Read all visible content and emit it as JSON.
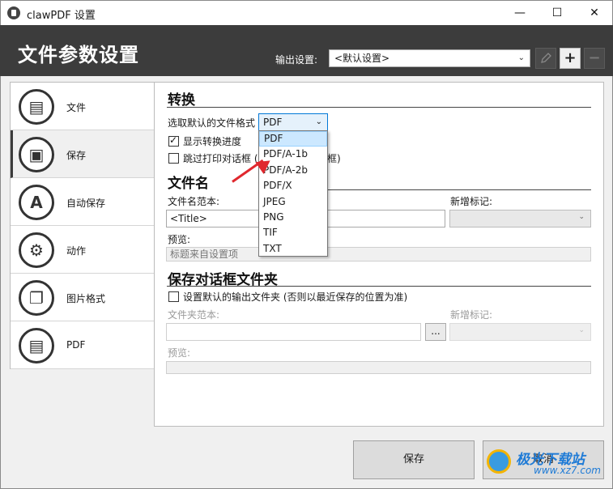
{
  "window": {
    "title": "clawPDF 设置",
    "minimize_glyph": "—",
    "maximize_glyph": "☐",
    "close_glyph": "✕"
  },
  "header": {
    "title": "文件参数设置",
    "output_label": "输出设置:",
    "output_value": "<默认设置>",
    "edit_icon": "pencil-icon",
    "add_label": "+",
    "remove_label": "−"
  },
  "sidebar": {
    "items": [
      {
        "label": "文件",
        "icon": "document-icon",
        "glyph": "▤"
      },
      {
        "label": "保存",
        "icon": "floppy-disk-icon",
        "glyph": "▣"
      },
      {
        "label": "自动保存",
        "icon": "auto-save-icon",
        "glyph": "A"
      },
      {
        "label": "动作",
        "icon": "gear-icon",
        "glyph": "⚙"
      },
      {
        "label": "图片格式",
        "icon": "images-icon",
        "glyph": "❐"
      },
      {
        "label": "PDF",
        "icon": "pdf-document-icon",
        "glyph": "▤"
      }
    ],
    "active_index": 1
  },
  "convert": {
    "title": "转换",
    "default_format_label": "选取默认的文件格式",
    "default_format_value": "PDF",
    "show_progress_label": "显示转换进度",
    "show_progress_checked": true,
    "skip_print_label": "跳过打印对话框 (",
    "skip_print_tail": "框)",
    "format_options": [
      "PDF",
      "PDF/A-1b",
      "PDF/A-2b",
      "PDF/X",
      "JPEG",
      "PNG",
      "TIF",
      "TXT"
    ],
    "selected_option": "PDF"
  },
  "filename": {
    "title": "文件名",
    "template_label": "文件名范本:",
    "template_value": "<Title>",
    "token_label": "新增标记:",
    "preview_label": "预览:",
    "preview_value": "标题来自设置项"
  },
  "save_dialog": {
    "title": "保存对话框文件夹",
    "default_folder_label": "设置默认的输出文件夹 (否则以最近保存的位置为准)",
    "folder_template_label": "文件夹范本:",
    "token_label": "新增标记:",
    "browse_label": "...",
    "preview_label": "预览:"
  },
  "footer": {
    "save_label": "保存",
    "cancel_label": "取消"
  },
  "watermark": {
    "name": "极光下载站",
    "url": "www.xz7.com"
  },
  "colors": {
    "header_bg": "#3c3c3c",
    "annotation_arrow": "#e0282e",
    "selection_bg": "#cce8ff"
  }
}
